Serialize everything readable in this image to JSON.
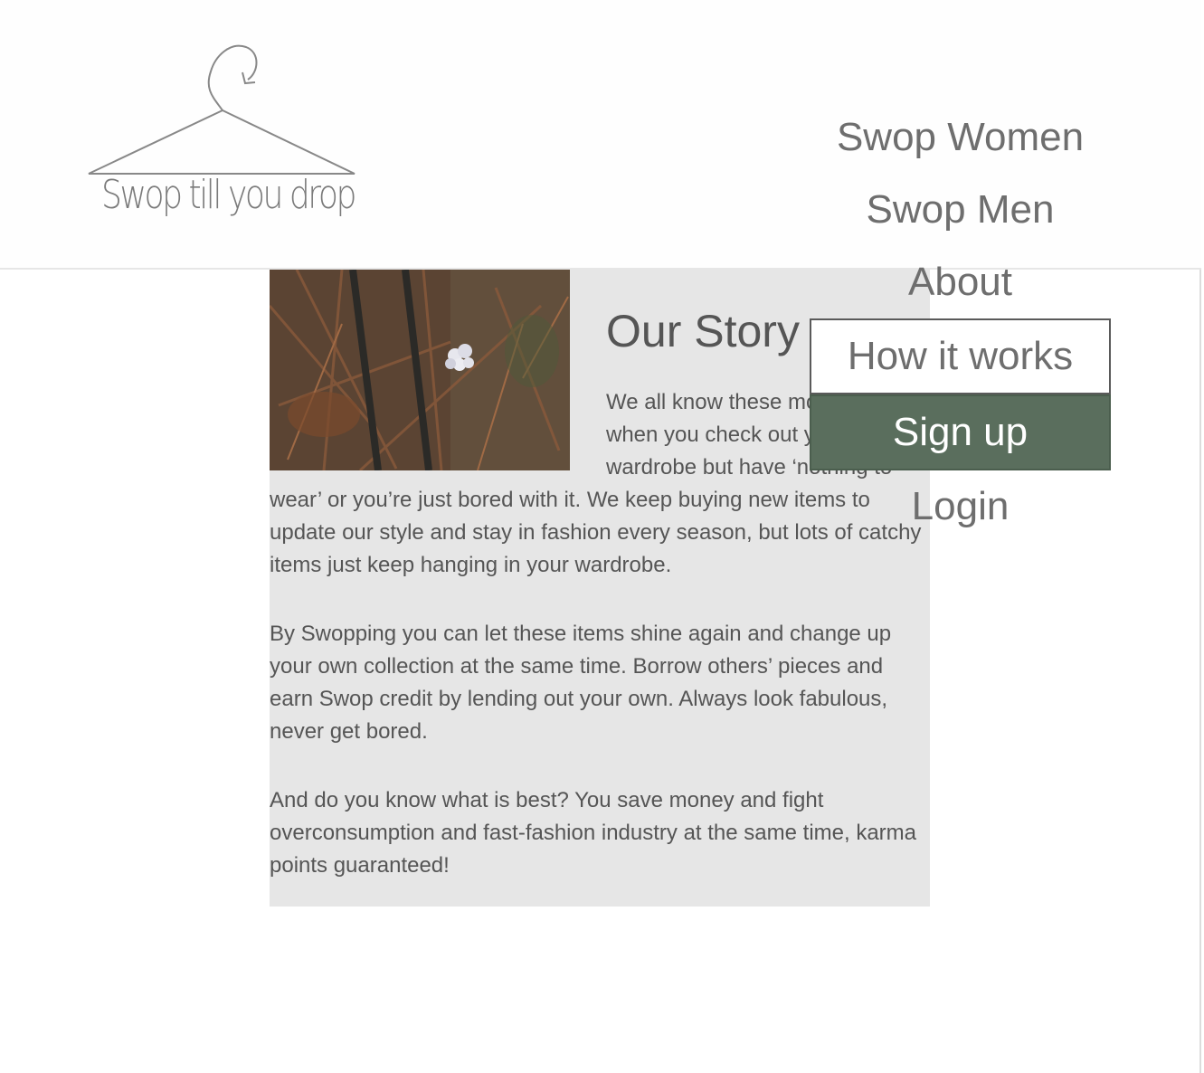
{
  "logo": {
    "text": "Swop till you drop"
  },
  "nav": {
    "items": [
      {
        "label": "Swop Women"
      },
      {
        "label": "Swop Men"
      },
      {
        "label": "About"
      },
      {
        "label": "How it works"
      },
      {
        "label": "Sign up"
      },
      {
        "label": "Login"
      }
    ]
  },
  "story": {
    "title": "Our Story",
    "paragraphs": [
      "We all know these moments when you check out your wardrobe but have ‘nothing to wear’ or you’re just bored with it. We keep buying new items to update our style and stay in fashion every season, but lots of catchy items just keep hanging in your wardrobe.",
      "By Swopping you can let these items shine again and change up your own collection at the same time. Borrow others’ pieces and earn Swop credit by lending out your own. Always look fabulous, never get bored.",
      "And do you know what is best? You save money and fight overconsumption and fast-fashion industry at the same time, karma points guaranteed!"
    ]
  },
  "colors": {
    "signup_bg": "#5a6e5d",
    "story_bg": "#e6e6e6",
    "text": "#555555"
  }
}
